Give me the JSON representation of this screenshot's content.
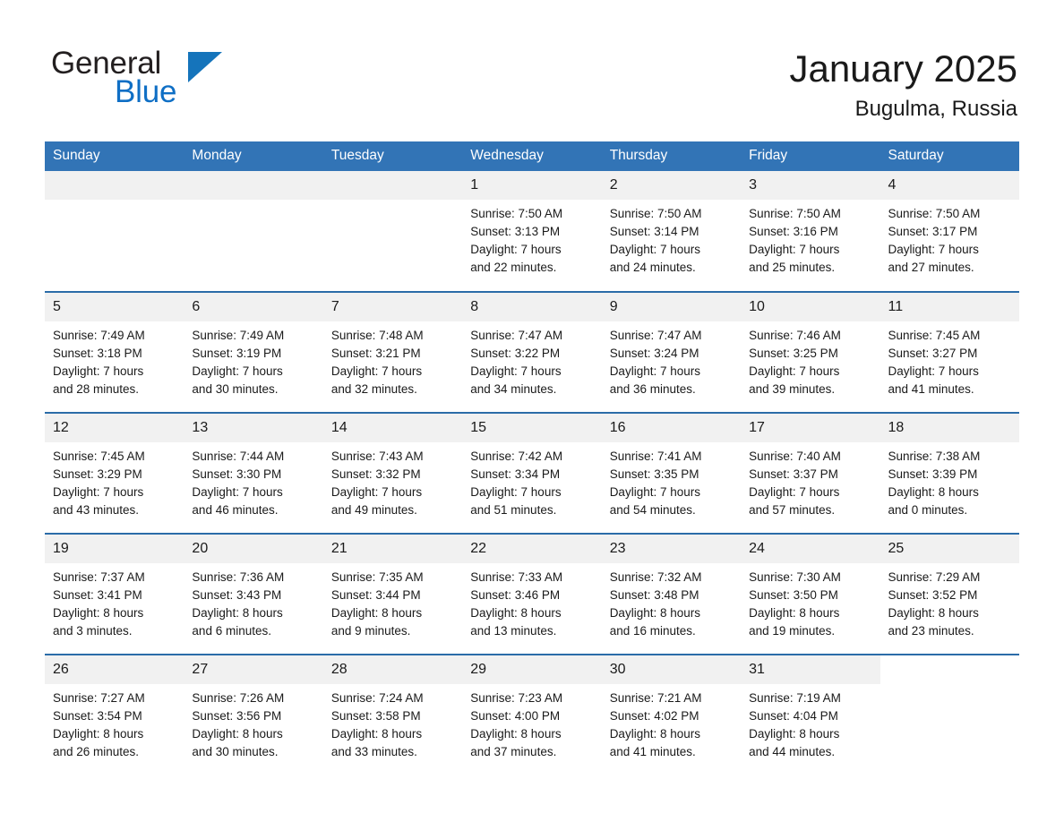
{
  "brand": {
    "word1": "General",
    "word2": "Blue",
    "triangle_color": "#1574bb",
    "blue_text_color": "#0f6fc5"
  },
  "header": {
    "month_title": "January 2025",
    "location": "Bugulma, Russia"
  },
  "theme": {
    "header_bg": "#3274b6",
    "row_divider": "#2b6ca8",
    "daynum_bg": "#f1f1f1",
    "text": "#1a1a1a"
  },
  "weekday_headers": [
    "Sunday",
    "Monday",
    "Tuesday",
    "Wednesday",
    "Thursday",
    "Friday",
    "Saturday"
  ],
  "weeks": [
    [
      {
        "day": "",
        "blank": true,
        "sunrise": "",
        "sunset": "",
        "daylight_line1": "",
        "daylight_line2": ""
      },
      {
        "day": "",
        "blank": true,
        "sunrise": "",
        "sunset": "",
        "daylight_line1": "",
        "daylight_line2": ""
      },
      {
        "day": "",
        "blank": true,
        "sunrise": "",
        "sunset": "",
        "daylight_line1": "",
        "daylight_line2": ""
      },
      {
        "day": "1",
        "sunrise": "Sunrise: 7:50 AM",
        "sunset": "Sunset: 3:13 PM",
        "daylight_line1": "Daylight: 7 hours",
        "daylight_line2": "and 22 minutes."
      },
      {
        "day": "2",
        "sunrise": "Sunrise: 7:50 AM",
        "sunset": "Sunset: 3:14 PM",
        "daylight_line1": "Daylight: 7 hours",
        "daylight_line2": "and 24 minutes."
      },
      {
        "day": "3",
        "sunrise": "Sunrise: 7:50 AM",
        "sunset": "Sunset: 3:16 PM",
        "daylight_line1": "Daylight: 7 hours",
        "daylight_line2": "and 25 minutes."
      },
      {
        "day": "4",
        "sunrise": "Sunrise: 7:50 AM",
        "sunset": "Sunset: 3:17 PM",
        "daylight_line1": "Daylight: 7 hours",
        "daylight_line2": "and 27 minutes."
      }
    ],
    [
      {
        "day": "5",
        "sunrise": "Sunrise: 7:49 AM",
        "sunset": "Sunset: 3:18 PM",
        "daylight_line1": "Daylight: 7 hours",
        "daylight_line2": "and 28 minutes."
      },
      {
        "day": "6",
        "sunrise": "Sunrise: 7:49 AM",
        "sunset": "Sunset: 3:19 PM",
        "daylight_line1": "Daylight: 7 hours",
        "daylight_line2": "and 30 minutes."
      },
      {
        "day": "7",
        "sunrise": "Sunrise: 7:48 AM",
        "sunset": "Sunset: 3:21 PM",
        "daylight_line1": "Daylight: 7 hours",
        "daylight_line2": "and 32 minutes."
      },
      {
        "day": "8",
        "sunrise": "Sunrise: 7:47 AM",
        "sunset": "Sunset: 3:22 PM",
        "daylight_line1": "Daylight: 7 hours",
        "daylight_line2": "and 34 minutes."
      },
      {
        "day": "9",
        "sunrise": "Sunrise: 7:47 AM",
        "sunset": "Sunset: 3:24 PM",
        "daylight_line1": "Daylight: 7 hours",
        "daylight_line2": "and 36 minutes."
      },
      {
        "day": "10",
        "sunrise": "Sunrise: 7:46 AM",
        "sunset": "Sunset: 3:25 PM",
        "daylight_line1": "Daylight: 7 hours",
        "daylight_line2": "and 39 minutes."
      },
      {
        "day": "11",
        "sunrise": "Sunrise: 7:45 AM",
        "sunset": "Sunset: 3:27 PM",
        "daylight_line1": "Daylight: 7 hours",
        "daylight_line2": "and 41 minutes."
      }
    ],
    [
      {
        "day": "12",
        "sunrise": "Sunrise: 7:45 AM",
        "sunset": "Sunset: 3:29 PM",
        "daylight_line1": "Daylight: 7 hours",
        "daylight_line2": "and 43 minutes."
      },
      {
        "day": "13",
        "sunrise": "Sunrise: 7:44 AM",
        "sunset": "Sunset: 3:30 PM",
        "daylight_line1": "Daylight: 7 hours",
        "daylight_line2": "and 46 minutes."
      },
      {
        "day": "14",
        "sunrise": "Sunrise: 7:43 AM",
        "sunset": "Sunset: 3:32 PM",
        "daylight_line1": "Daylight: 7 hours",
        "daylight_line2": "and 49 minutes."
      },
      {
        "day": "15",
        "sunrise": "Sunrise: 7:42 AM",
        "sunset": "Sunset: 3:34 PM",
        "daylight_line1": "Daylight: 7 hours",
        "daylight_line2": "and 51 minutes."
      },
      {
        "day": "16",
        "sunrise": "Sunrise: 7:41 AM",
        "sunset": "Sunset: 3:35 PM",
        "daylight_line1": "Daylight: 7 hours",
        "daylight_line2": "and 54 minutes."
      },
      {
        "day": "17",
        "sunrise": "Sunrise: 7:40 AM",
        "sunset": "Sunset: 3:37 PM",
        "daylight_line1": "Daylight: 7 hours",
        "daylight_line2": "and 57 minutes."
      },
      {
        "day": "18",
        "sunrise": "Sunrise: 7:38 AM",
        "sunset": "Sunset: 3:39 PM",
        "daylight_line1": "Daylight: 8 hours",
        "daylight_line2": "and 0 minutes."
      }
    ],
    [
      {
        "day": "19",
        "sunrise": "Sunrise: 7:37 AM",
        "sunset": "Sunset: 3:41 PM",
        "daylight_line1": "Daylight: 8 hours",
        "daylight_line2": "and 3 minutes."
      },
      {
        "day": "20",
        "sunrise": "Sunrise: 7:36 AM",
        "sunset": "Sunset: 3:43 PM",
        "daylight_line1": "Daylight: 8 hours",
        "daylight_line2": "and 6 minutes."
      },
      {
        "day": "21",
        "sunrise": "Sunrise: 7:35 AM",
        "sunset": "Sunset: 3:44 PM",
        "daylight_line1": "Daylight: 8 hours",
        "daylight_line2": "and 9 minutes."
      },
      {
        "day": "22",
        "sunrise": "Sunrise: 7:33 AM",
        "sunset": "Sunset: 3:46 PM",
        "daylight_line1": "Daylight: 8 hours",
        "daylight_line2": "and 13 minutes."
      },
      {
        "day": "23",
        "sunrise": "Sunrise: 7:32 AM",
        "sunset": "Sunset: 3:48 PM",
        "daylight_line1": "Daylight: 8 hours",
        "daylight_line2": "and 16 minutes."
      },
      {
        "day": "24",
        "sunrise": "Sunrise: 7:30 AM",
        "sunset": "Sunset: 3:50 PM",
        "daylight_line1": "Daylight: 8 hours",
        "daylight_line2": "and 19 minutes."
      },
      {
        "day": "25",
        "sunrise": "Sunrise: 7:29 AM",
        "sunset": "Sunset: 3:52 PM",
        "daylight_line1": "Daylight: 8 hours",
        "daylight_line2": "and 23 minutes."
      }
    ],
    [
      {
        "day": "26",
        "sunrise": "Sunrise: 7:27 AM",
        "sunset": "Sunset: 3:54 PM",
        "daylight_line1": "Daylight: 8 hours",
        "daylight_line2": "and 26 minutes."
      },
      {
        "day": "27",
        "sunrise": "Sunrise: 7:26 AM",
        "sunset": "Sunset: 3:56 PM",
        "daylight_line1": "Daylight: 8 hours",
        "daylight_line2": "and 30 minutes."
      },
      {
        "day": "28",
        "sunrise": "Sunrise: 7:24 AM",
        "sunset": "Sunset: 3:58 PM",
        "daylight_line1": "Daylight: 8 hours",
        "daylight_line2": "and 33 minutes."
      },
      {
        "day": "29",
        "sunrise": "Sunrise: 7:23 AM",
        "sunset": "Sunset: 4:00 PM",
        "daylight_line1": "Daylight: 8 hours",
        "daylight_line2": "and 37 minutes."
      },
      {
        "day": "30",
        "sunrise": "Sunrise: 7:21 AM",
        "sunset": "Sunset: 4:02 PM",
        "daylight_line1": "Daylight: 8 hours",
        "daylight_line2": "and 41 minutes."
      },
      {
        "day": "31",
        "sunrise": "Sunrise: 7:19 AM",
        "sunset": "Sunset: 4:04 PM",
        "daylight_line1": "Daylight: 8 hours",
        "daylight_line2": "and 44 minutes."
      },
      {
        "day": "",
        "void": true,
        "sunrise": "",
        "sunset": "",
        "daylight_line1": "",
        "daylight_line2": ""
      }
    ]
  ]
}
